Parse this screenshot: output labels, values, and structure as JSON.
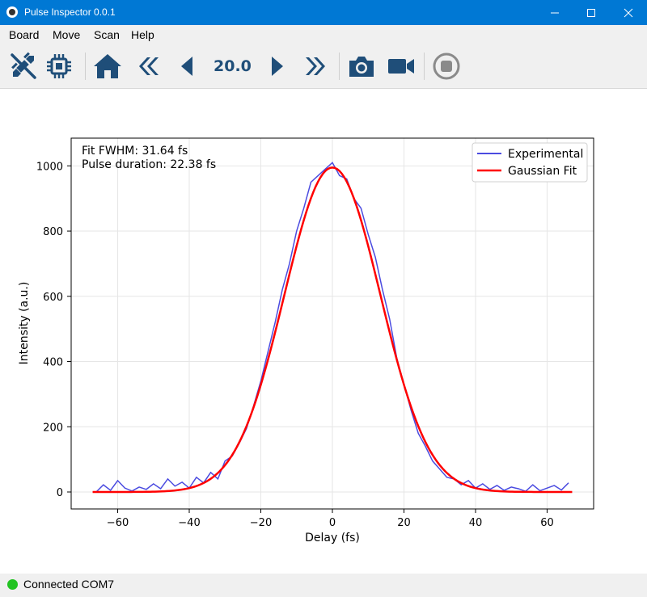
{
  "window": {
    "title": "Pulse Inspector 0.0.1"
  },
  "menu": [
    "Board",
    "Move",
    "Scan",
    "Help"
  ],
  "toolbar": {
    "step_value": "20.0",
    "icon_color": "#1f4e79",
    "icons": [
      "disconnect-plug-icon",
      "chip-icon",
      "home-icon",
      "fast-backward-icon",
      "step-backward-icon",
      "step-forward-icon",
      "fast-forward-icon",
      "camera-icon",
      "video-camera-icon",
      "stop-icon"
    ]
  },
  "plot": {
    "annotation_lines": [
      "Fit FWHM: 31.64 fs",
      "Pulse duration: 22.38 fs"
    ]
  },
  "chart_data": {
    "type": "line",
    "xlabel": "Delay (fs)",
    "ylabel": "Intensity (a.u.)",
    "xlim": [
      -73,
      73
    ],
    "ylim": [
      -52,
      1085
    ],
    "xticks": [
      -60,
      -40,
      -20,
      0,
      20,
      40,
      60
    ],
    "yticks": [
      0,
      200,
      400,
      600,
      800,
      1000
    ],
    "grid": true,
    "legend_position": "top-right",
    "series": [
      {
        "name": "Experimental",
        "color": "#4b4be0",
        "x": [
          -66,
          -64,
          -62,
          -60,
          -58,
          -56,
          -54,
          -52,
          -50,
          -48,
          -46,
          -44,
          -42,
          -40,
          -38,
          -36,
          -34,
          -32,
          -30,
          -28,
          -26,
          -24,
          -22,
          -20,
          -18,
          -16,
          -14,
          -12,
          -10,
          -8,
          -6,
          -4,
          -2,
          0,
          2,
          4,
          6,
          8,
          10,
          12,
          14,
          16,
          18,
          20,
          22,
          24,
          26,
          28,
          30,
          32,
          34,
          36,
          38,
          40,
          42,
          44,
          46,
          48,
          50,
          52,
          54,
          56,
          58,
          60,
          62,
          64,
          66
        ],
        "y": [
          0,
          22,
          5,
          35,
          12,
          3,
          15,
          8,
          25,
          10,
          40,
          18,
          30,
          12,
          45,
          28,
          60,
          40,
          95,
          110,
          150,
          195,
          265,
          340,
          430,
          520,
          620,
          700,
          800,
          870,
          950,
          970,
          990,
          1010,
          970,
          960,
          900,
          870,
          790,
          720,
          620,
          530,
          410,
          330,
          250,
          180,
          140,
          95,
          70,
          45,
          40,
          22,
          35,
          12,
          25,
          8,
          20,
          5,
          15,
          10,
          2,
          22,
          4,
          12,
          20,
          6,
          28
        ]
      },
      {
        "name": "Gaussian Fit",
        "color": "#ff0000",
        "amplitude": 995,
        "center": 0,
        "fwhm": 31.64,
        "x_range": [
          -67,
          67
        ]
      }
    ]
  },
  "statusbar": {
    "text": "Connected COM7",
    "dot_color": "#22c322"
  }
}
